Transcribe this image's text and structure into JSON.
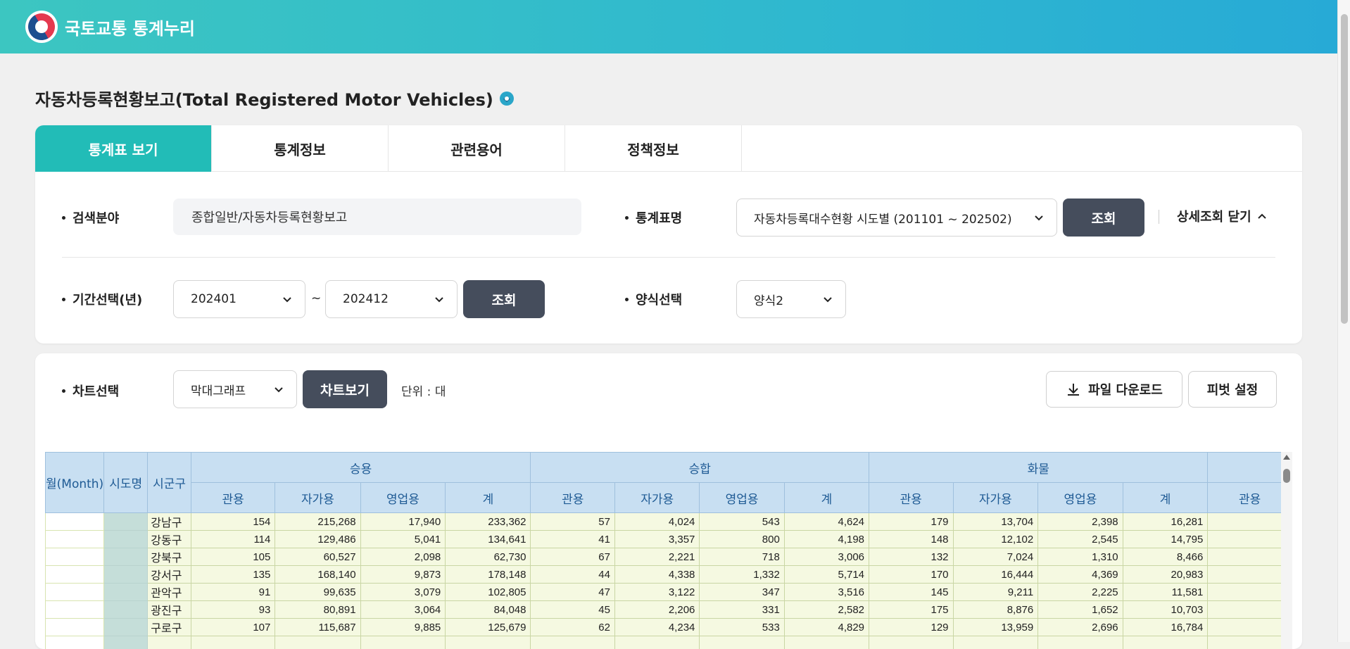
{
  "header": {
    "brand": "국토교통 통계누리"
  },
  "page": {
    "title": "자동차등록현황보고(Total Registered Motor Vehicles)"
  },
  "tabs": [
    {
      "label": "통계표 보기",
      "active": true
    },
    {
      "label": "통계정보",
      "active": false
    },
    {
      "label": "관련용어",
      "active": false
    },
    {
      "label": "정책정보",
      "active": false
    }
  ],
  "search": {
    "field_label": "검색분야",
    "field_value": "종합일반/자동차등록현황보고",
    "table_label": "통계표명",
    "table_value": "자동차등록대수현황 시도별 (201101 ~ 202502)",
    "query_button": "조회",
    "detail_toggle": "상세조회 닫기",
    "period_label": "기간선택(년)",
    "period_from": "202401",
    "period_sep": "~",
    "period_to": "202412",
    "period_query_button": "조회",
    "format_label": "양식선택",
    "format_value": "양식2"
  },
  "chart_controls": {
    "label": "차트선택",
    "chart_type": "막대그래프",
    "view_button": "차트보기",
    "unit": "단위 : 대",
    "download_button": "파일 다운로드",
    "pivot_button": "피벗 설정"
  },
  "grid": {
    "fixed_headers": [
      "월(Month)",
      "시도명",
      "시군구"
    ],
    "groups": [
      "승용",
      "승합",
      "화물",
      ""
    ],
    "sub_headers": [
      "관용",
      "자가용",
      "영업용",
      "계",
      "관용",
      "자가용",
      "영업용",
      "계",
      "관용",
      "자가용",
      "영업용",
      "계",
      "관용"
    ],
    "rows": [
      {
        "month": "",
        "sido": "",
        "sigungu": "강남구",
        "values": [
          "154",
          "215,268",
          "17,940",
          "233,362",
          "57",
          "4,024",
          "543",
          "4,624",
          "179",
          "13,704",
          "2,398",
          "16,281",
          ""
        ]
      },
      {
        "month": "",
        "sido": "",
        "sigungu": "강동구",
        "values": [
          "114",
          "129,486",
          "5,041",
          "134,641",
          "41",
          "3,357",
          "800",
          "4,198",
          "148",
          "12,102",
          "2,545",
          "14,795",
          ""
        ]
      },
      {
        "month": "",
        "sido": "",
        "sigungu": "강북구",
        "values": [
          "105",
          "60,527",
          "2,098",
          "62,730",
          "67",
          "2,221",
          "718",
          "3,006",
          "132",
          "7,024",
          "1,310",
          "8,466",
          ""
        ]
      },
      {
        "month": "",
        "sido": "",
        "sigungu": "강서구",
        "values": [
          "135",
          "168,140",
          "9,873",
          "178,148",
          "44",
          "4,338",
          "1,332",
          "5,714",
          "170",
          "16,444",
          "4,369",
          "20,983",
          ""
        ]
      },
      {
        "month": "",
        "sido": "",
        "sigungu": "관악구",
        "values": [
          "91",
          "99,635",
          "3,079",
          "102,805",
          "47",
          "3,122",
          "347",
          "3,516",
          "145",
          "9,211",
          "2,225",
          "11,581",
          ""
        ]
      },
      {
        "month": "",
        "sido": "",
        "sigungu": "광진구",
        "values": [
          "93",
          "80,891",
          "3,064",
          "84,048",
          "45",
          "2,206",
          "331",
          "2,582",
          "175",
          "8,876",
          "1,652",
          "10,703",
          ""
        ]
      },
      {
        "month": "",
        "sido": "",
        "sigungu": "구로구",
        "values": [
          "107",
          "115,687",
          "9,885",
          "125,679",
          "62",
          "4,234",
          "533",
          "4,829",
          "129",
          "13,959",
          "2,696",
          "16,784",
          ""
        ]
      },
      {
        "month": "",
        "sido": "",
        "sigungu": "",
        "values": [
          "",
          "",
          "",
          "",
          "",
          "",
          "",
          "",
          "",
          "",
          "",
          "",
          ""
        ]
      }
    ]
  }
}
